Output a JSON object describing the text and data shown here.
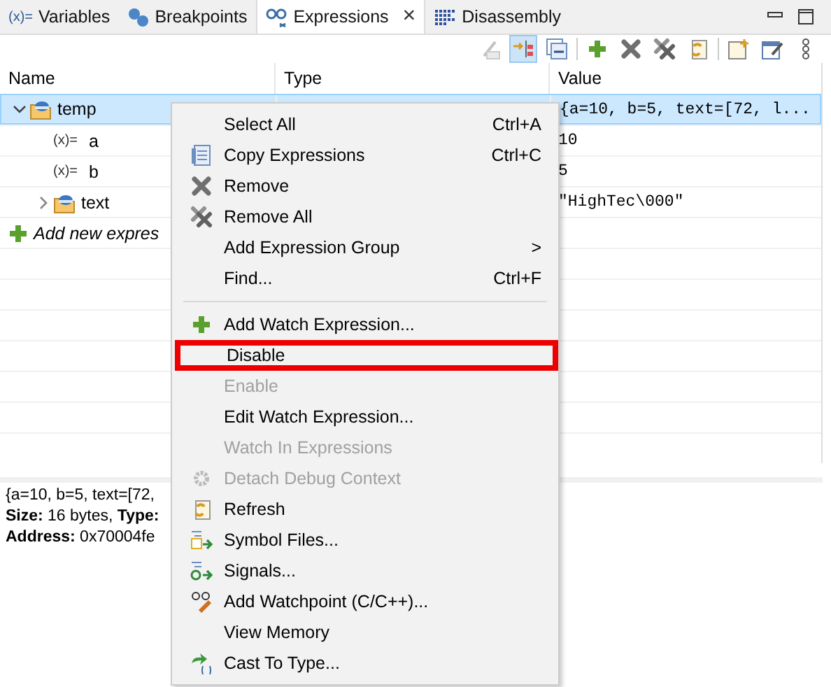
{
  "tabs": [
    {
      "label": "Variables",
      "icon_text": "(x)=",
      "selected": false
    },
    {
      "label": "Breakpoints",
      "selected": false
    },
    {
      "label": "Expressions",
      "selected": true,
      "close": "×"
    },
    {
      "label": "Disassembly",
      "selected": false
    }
  ],
  "toolbar": [
    {
      "disabled": true,
      "on": false
    },
    {
      "disabled": false,
      "on": true
    },
    {
      "disabled": false,
      "on": false
    },
    {
      "disabled": false,
      "on": false
    },
    {
      "disabled": false,
      "on": false
    },
    {
      "disabled": false,
      "on": false
    },
    {
      "disabled": false,
      "on": false
    },
    {
      "disabled": false,
      "on": false
    },
    {
      "disabled": false,
      "on": false
    },
    {
      "disabled": false,
      "on": false
    }
  ],
  "table": {
    "columns": [
      "Name",
      "Type",
      "Value"
    ],
    "rows": [
      {
        "kind": "struct",
        "name": "temp",
        "value": "{a=10, b=5, text=[72, l...",
        "selected": true,
        "expanded": true,
        "children": [
          {
            "kind": "variable",
            "icon_text": "(x)=",
            "name": "a",
            "value": "10",
            "selected": false
          },
          {
            "kind": "variable",
            "icon_text": "(x)=",
            "name": "b",
            "value": "5",
            "selected": false
          },
          {
            "kind": "struct",
            "name": "text",
            "value": "\"HighTec\\000\"",
            "selected": false,
            "expanded": false
          }
        ]
      },
      {
        "kind": "add",
        "name": "Add new expres",
        "selected": false
      }
    ]
  },
  "details": [
    "{a=10, b=5, text=[72,",
    "**Size:** 16 bytes, **Type:**",
    "**Address:** 0x70004fe"
  ],
  "context_menu": [
    {
      "kind": "item",
      "label": "Select All",
      "shortcut": "Ctrl+A",
      "disabled": false,
      "highlighted": false
    },
    {
      "kind": "item",
      "label": "Copy Expressions",
      "shortcut": "Ctrl+C",
      "disabled": false,
      "highlighted": false
    },
    {
      "kind": "item",
      "label": "Remove",
      "disabled": false,
      "highlighted": false
    },
    {
      "kind": "item",
      "label": "Remove All",
      "disabled": false,
      "highlighted": false
    },
    {
      "kind": "item",
      "label": "Add Expression Group",
      "submenu": ">",
      "disabled": false,
      "highlighted": false
    },
    {
      "kind": "item",
      "label": "Find...",
      "shortcut": "Ctrl+F",
      "disabled": false,
      "highlighted": false
    },
    {
      "kind": "separator"
    },
    {
      "kind": "item",
      "label": "Add Watch Expression...",
      "disabled": false,
      "highlighted": false
    },
    {
      "kind": "item",
      "label": "Disable",
      "disabled": false,
      "highlighted": true
    },
    {
      "kind": "item",
      "label": "Enable",
      "disabled": true,
      "highlighted": false
    },
    {
      "kind": "item",
      "label": "Edit Watch Expression...",
      "disabled": false,
      "highlighted": false
    },
    {
      "kind": "item",
      "label": "Watch In Expressions",
      "disabled": true,
      "highlighted": false
    },
    {
      "kind": "item",
      "label": "Detach Debug Context",
      "disabled": true,
      "highlighted": false
    },
    {
      "kind": "item",
      "label": "Refresh",
      "disabled": false,
      "highlighted": false
    },
    {
      "kind": "item",
      "label": "Symbol Files...",
      "disabled": false,
      "highlighted": false
    },
    {
      "kind": "item",
      "label": "Signals...",
      "disabled": false,
      "highlighted": false
    },
    {
      "kind": "item",
      "label": "Add Watchpoint (C/C++)...",
      "disabled": false,
      "highlighted": false
    },
    {
      "kind": "item",
      "label": "View Memory",
      "disabled": false,
      "highlighted": false
    },
    {
      "kind": "item",
      "label": "Cast To Type...",
      "disabled": false,
      "highlighted": false
    }
  ]
}
